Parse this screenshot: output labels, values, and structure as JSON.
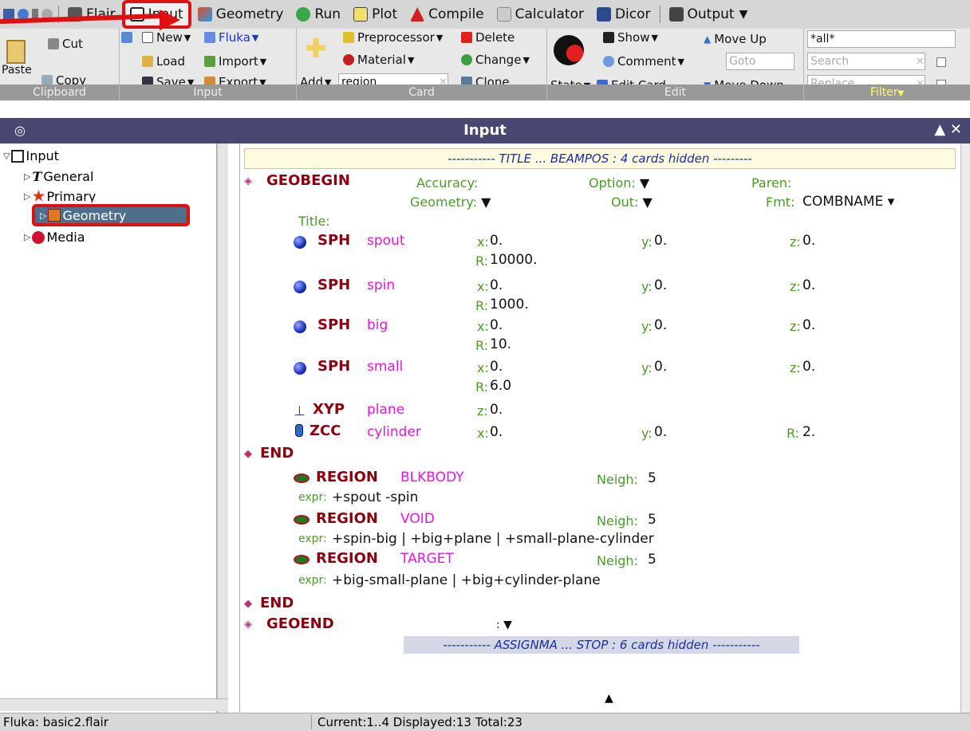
{
  "tabs": [
    {
      "label": "Flair",
      "icon": "flair-icon"
    },
    {
      "label": "Input",
      "icon": "input-icon"
    },
    {
      "label": "Geometry",
      "icon": "geometry-icon"
    },
    {
      "label": "Run",
      "icon": "run-icon"
    },
    {
      "label": "Plot",
      "icon": "plot-icon"
    },
    {
      "label": "Compile",
      "icon": "compile-icon"
    },
    {
      "label": "Calculator",
      "icon": "calculator-icon"
    },
    {
      "label": "Dicor",
      "icon": "dicor-icon"
    },
    {
      "label": "Output",
      "icon": "output-icon"
    }
  ],
  "ribbon": {
    "clipboard": {
      "paste": "Paste",
      "cut": "Cut",
      "copy": "Copy",
      "label": "Clipboard"
    },
    "input": {
      "new": "New",
      "load": "Load",
      "save": "Save",
      "fluka": "Fluka",
      "import": "Import",
      "export": "Export",
      "label": "Input"
    },
    "card": {
      "add": "Add",
      "add_value": "region",
      "preprocessor": "Preprocessor",
      "material": "Material",
      "delete": "Delete",
      "change": "Change",
      "clone": "Clone",
      "label": "Card"
    },
    "edit": {
      "state": "State",
      "show": "Show",
      "comment": "Comment",
      "edit_card": "Edit Card",
      "move_up": "Move Up",
      "move_down": "Move Down",
      "goto_placeholder": "Goto",
      "label": "Edit"
    },
    "filter": {
      "all_value": "*all*",
      "search_placeholder": "Search",
      "replace_placeholder": "Replace",
      "label": "Filter"
    }
  },
  "window": {
    "title": "Input"
  },
  "tree": {
    "root": "Input",
    "items": [
      "General",
      "Primary",
      "Geometry",
      "Media"
    ]
  },
  "editor": {
    "hidden_top": "----------- TITLE ... BEAMPOS : 4 cards hidden ---------",
    "hidden_bottom": "----------- ASSIGNMA ... STOP : 6 cards hidden -----------",
    "geobegin": {
      "kw": "GEOBEGIN",
      "accuracy": "Accuracy:",
      "option": "Option:",
      "paren": "Paren:",
      "geometry": "Geometry:",
      "out": "Out:",
      "fmt": "Fmt:",
      "fmt_value": "COMBNAME",
      "title": "Title:"
    },
    "bodies": [
      {
        "kw": "SPH",
        "name": "spout",
        "x": "0.",
        "y": "0.",
        "z": "0.",
        "R": "10000."
      },
      {
        "kw": "SPH",
        "name": "spin",
        "x": "0.",
        "y": "0.",
        "z": "0.",
        "R": "1000."
      },
      {
        "kw": "SPH",
        "name": "big",
        "x": "0.",
        "y": "0.",
        "z": "0.",
        "R": "10."
      },
      {
        "kw": "SPH",
        "name": "small",
        "x": "0.",
        "y": "0.",
        "z": "0.",
        "R": "6.0"
      }
    ],
    "xyp": {
      "kw": "XYP",
      "name": "plane",
      "z": "0."
    },
    "zcc": {
      "kw": "ZCC",
      "name": "cylinder",
      "x": "0.",
      "y": "0.",
      "R": "2."
    },
    "end1": "END",
    "regions": [
      {
        "kw": "REGION",
        "name": "BLKBODY",
        "neigh": "5",
        "expr": "+spout -spin"
      },
      {
        "kw": "REGION",
        "name": "VOID",
        "neigh": "5",
        "expr": "+spin-big | +big+plane | +small-plane-cylinder"
      },
      {
        "kw": "REGION",
        "name": "TARGET",
        "neigh": "5",
        "expr": "+big-small-plane | +big+cylinder-plane"
      }
    ],
    "end2": "END",
    "geoend": "GEOEND",
    "labels": {
      "x": "x:",
      "y": "y:",
      "z": "z:",
      "R": "R:",
      "neigh": "Neigh:",
      "expr": "expr:"
    }
  },
  "status": {
    "file": "Fluka: basic2.flair",
    "counts": "Current:1..4  Displayed:13 Total:23"
  },
  "colors": {
    "accent_red": "#e01010",
    "title_bar": "#4a4672",
    "keyword": "#8a0010",
    "name": "#e018e0",
    "label": "#4a9a2a"
  }
}
